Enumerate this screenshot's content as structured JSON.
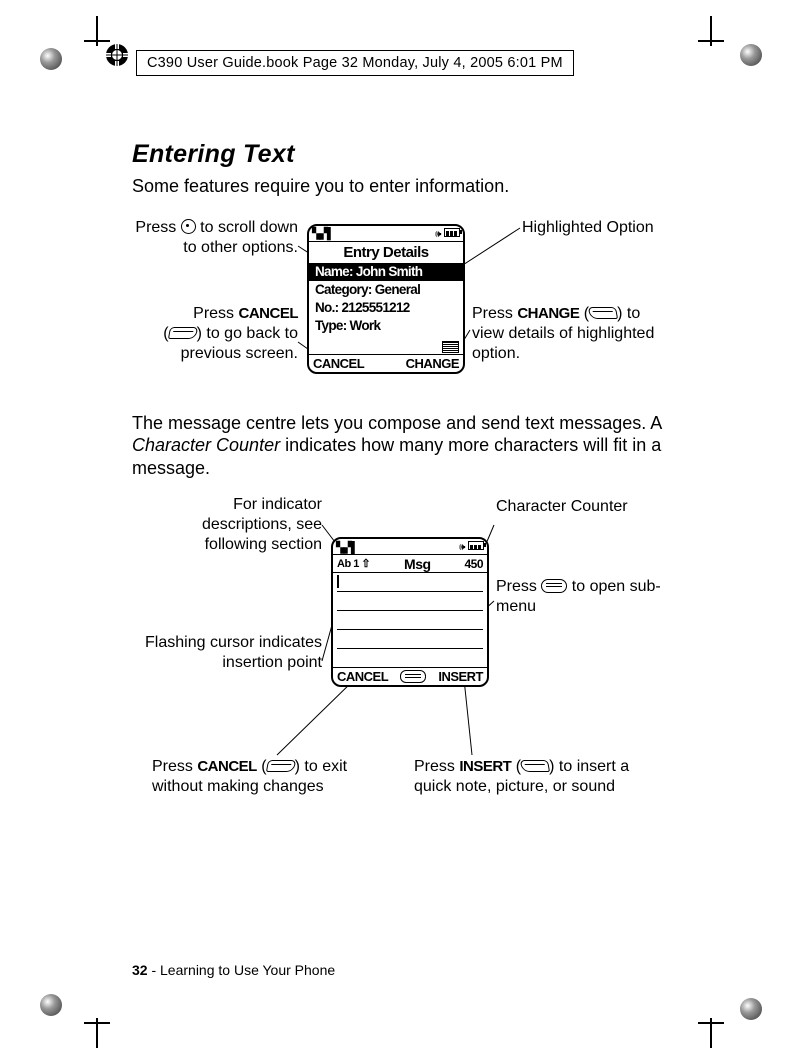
{
  "book_header": "C390 User Guide.book  Page 32  Monday, July 4, 2005  6:01 PM",
  "section_title": "Entering Text",
  "intro": "Some features require you to enter information.",
  "para2_a": "The message centre lets you compose and send text messages. A ",
  "para2_em": "Character Counter",
  "para2_b": " indicates how many more characters will fit in a message.",
  "footer_page": "32",
  "footer_text": " - Learning to Use Your Phone",
  "fig1": {
    "c1a": "Press ",
    "c1b": " to scroll down to other options.",
    "c2a": "Press ",
    "c2kw": "CANCEL",
    "c2b": " (",
    "c2c": ") to go back to previous screen.",
    "c3": "Highlighted Option",
    "c4a": "Press ",
    "c4kw": "CHANGE",
    "c4b": " (",
    "c4c": ") to view details of highlighted option.",
    "scr_title": "Entry Details",
    "row1": "Name: John Smith",
    "row2": "Category: General",
    "row3": "No.: 2125551212",
    "row4": "Type: Work",
    "sk_left": "CANCEL",
    "sk_right": "CHANGE"
  },
  "fig2": {
    "c1": "For indicator descriptions, see following section",
    "c2": "Flashing cursor indicates insertion point",
    "c3": "Character Counter",
    "c4a": "Press ",
    "c4b": " to open sub-menu",
    "c5a": "Press ",
    "c5kw": "CANCEL",
    "c5b": " (",
    "c5c": ") to exit without making changes",
    "c6a": "Press ",
    "c6kw": "INSERT",
    "c6b": " (",
    "c6c": ") to insert a quick note, picture, or sound",
    "indicator": "Ab 1 ⇧",
    "title": "Msg",
    "counter": "450",
    "sk_left": "CANCEL",
    "sk_right": "INSERT"
  }
}
